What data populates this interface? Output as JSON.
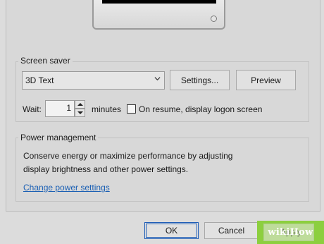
{
  "screen_saver": {
    "group_label": "Screen saver",
    "selected": "3D Text",
    "settings_button": "Settings...",
    "preview_button": "Preview",
    "wait_label": "Wait:",
    "wait_value": "1",
    "minutes_label": "minutes",
    "resume_label": "On resume, display logon screen",
    "resume_checked": false
  },
  "power": {
    "group_label": "Power management",
    "line1": "Conserve energy or maximize performance by adjusting",
    "line2": "display brightness and other power settings.",
    "link": "Change power settings"
  },
  "footer": {
    "ok": "OK",
    "cancel": "Cancel",
    "apply": "Apply"
  },
  "watermark": {
    "text": "wikiHow",
    "color": "#8ccf3f"
  },
  "colors": {
    "link": "#1a5fb4",
    "focus_border": "#1f5db6"
  }
}
